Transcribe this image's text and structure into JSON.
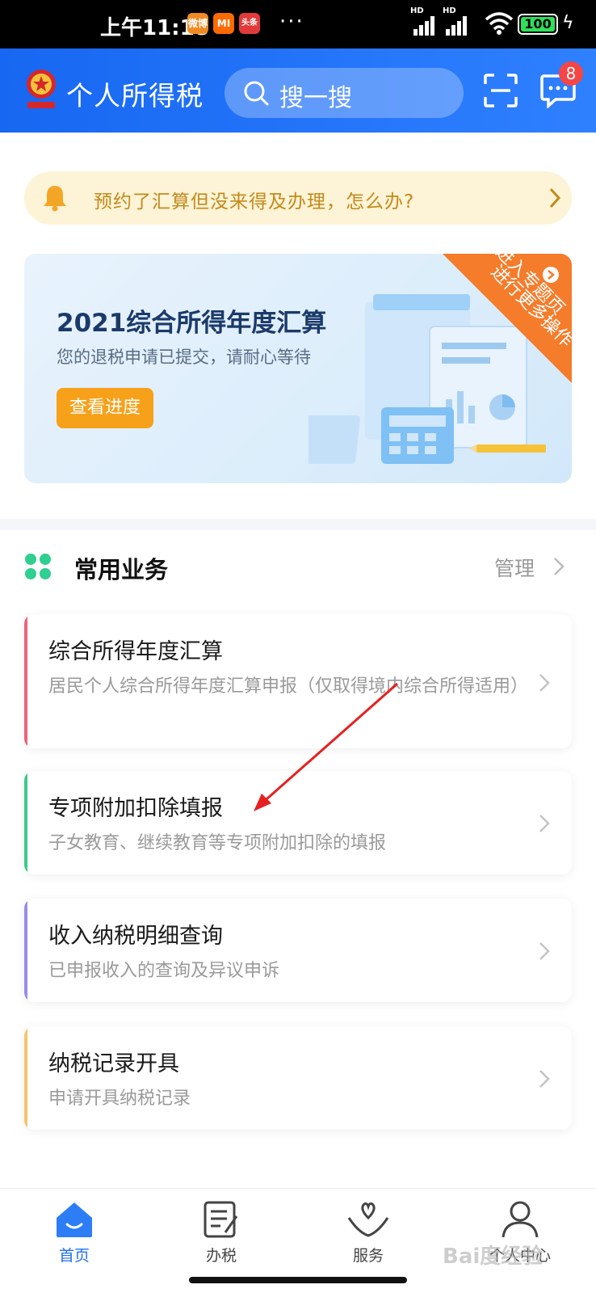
{
  "status_bar": {
    "time": "上午11:18",
    "apps": [
      "微博",
      "MI",
      "头条"
    ],
    "more": "···",
    "network": [
      "HD",
      "HD"
    ],
    "battery": "100"
  },
  "header": {
    "title": "个人所得税",
    "search_placeholder": "搜一搜",
    "message_badge": "8"
  },
  "notice": {
    "text": "预约了汇算但没来得及办理，怎么办?"
  },
  "banner": {
    "title": "2021综合所得年度汇算",
    "subtitle": "您的退税申请已提交，请耐心等待",
    "button": "查看进度",
    "ribbon_line1": "进入专题页",
    "ribbon_line2": "进行更多操作"
  },
  "services": {
    "title": "常用业务",
    "manage": "管理",
    "items": [
      {
        "title": "综合所得年度汇算",
        "desc": "居民个人综合所得年度汇算申报（仅取得境内综合所得适用）",
        "accent": "#e8637a"
      },
      {
        "title": "专项附加扣除填报",
        "desc": "子女教育、继续教育等专项附加扣除的填报",
        "accent": "#3cc98a"
      },
      {
        "title": "收入纳税明细查询",
        "desc": "已申报收入的查询及异议申诉",
        "accent": "#9a8ce8"
      },
      {
        "title": "纳税记录开具",
        "desc": "申请开具纳税记录",
        "accent": "#f3c46a"
      }
    ]
  },
  "bottom_nav": {
    "items": [
      {
        "label": "首页",
        "icon": "home-icon"
      },
      {
        "label": "办税",
        "icon": "tax-form-icon"
      },
      {
        "label": "服务",
        "icon": "heart-hand-icon"
      },
      {
        "label": "个人中心",
        "icon": "person-icon"
      }
    ]
  },
  "watermark": "Bai度经验",
  "colors": {
    "brand_blue": "#1d6ff3",
    "orange": "#f7a11a",
    "notice_text": "#c38a1a"
  }
}
